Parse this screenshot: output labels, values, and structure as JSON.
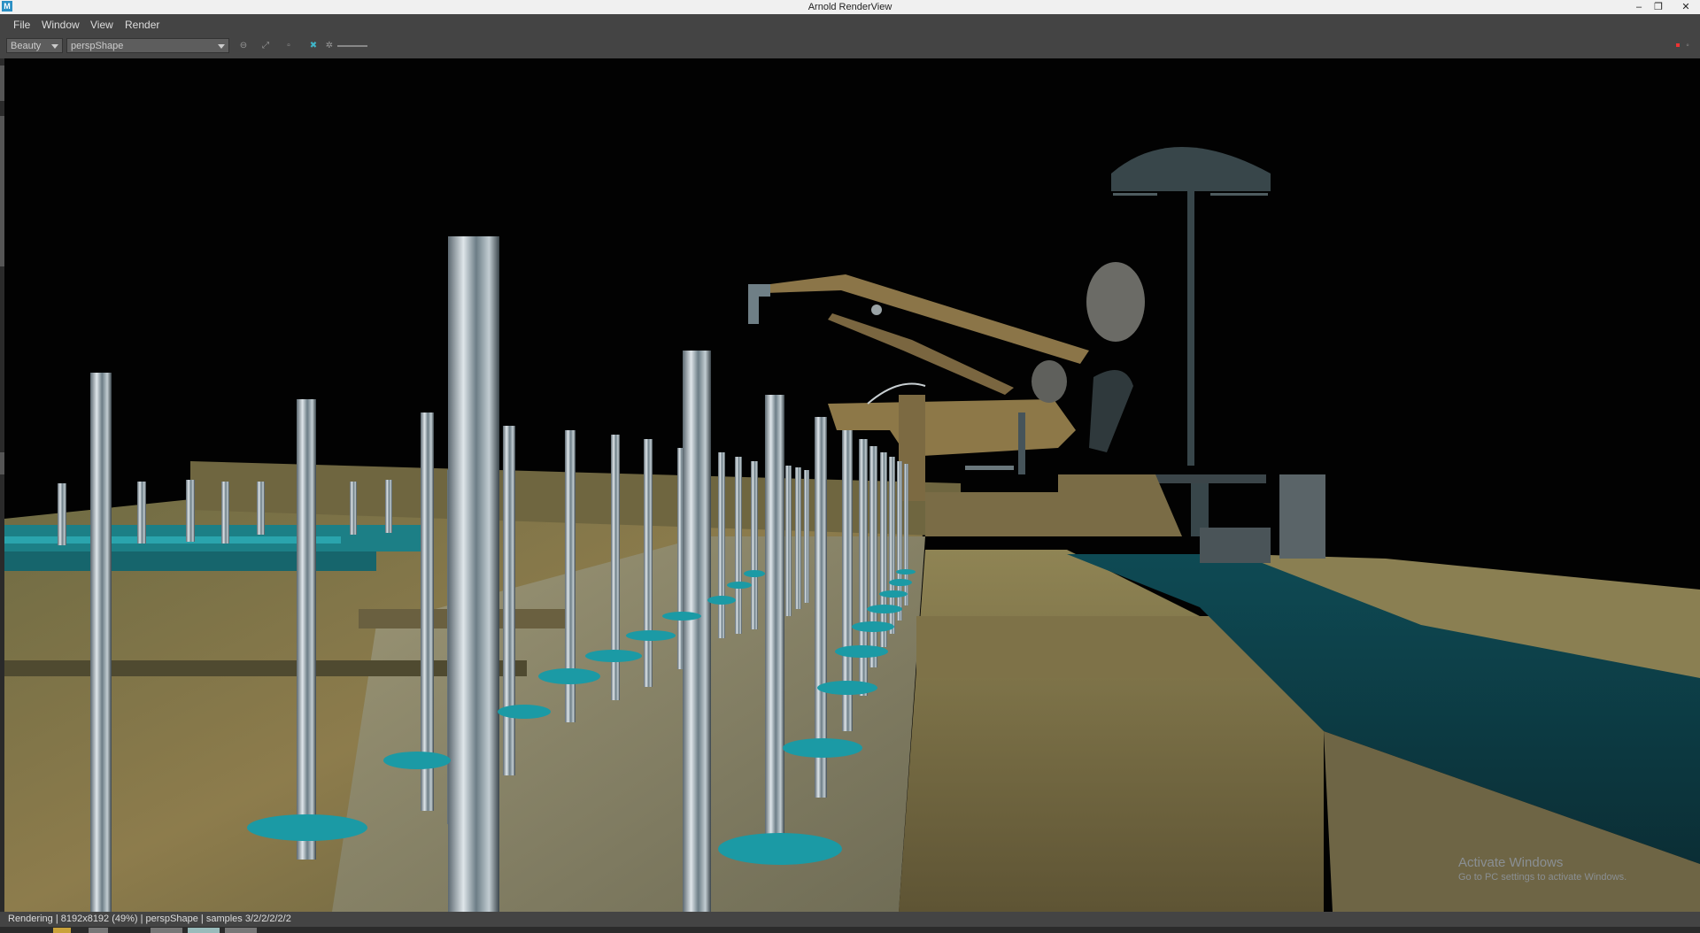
{
  "window": {
    "title": "Arnold RenderView",
    "app_icon": "M",
    "controls": [
      "–",
      "❐",
      "✕"
    ]
  },
  "menu": [
    "File",
    "Window",
    "View",
    "Render"
  ],
  "toolbar": {
    "aov": "Beauty",
    "camera": "perspShape"
  },
  "status": {
    "text": "Rendering | 8192x8192 (49%) | perspShape  | samples 3/2/2/2/2/2"
  },
  "watermark": {
    "title": "Activate Windows",
    "subtitle": "Go to PC settings to activate Windows."
  },
  "colors": {
    "background": "#020202",
    "wood": "#8a7a4a",
    "teal": "#1b9aa5",
    "chrome": "#b8c6cc"
  }
}
